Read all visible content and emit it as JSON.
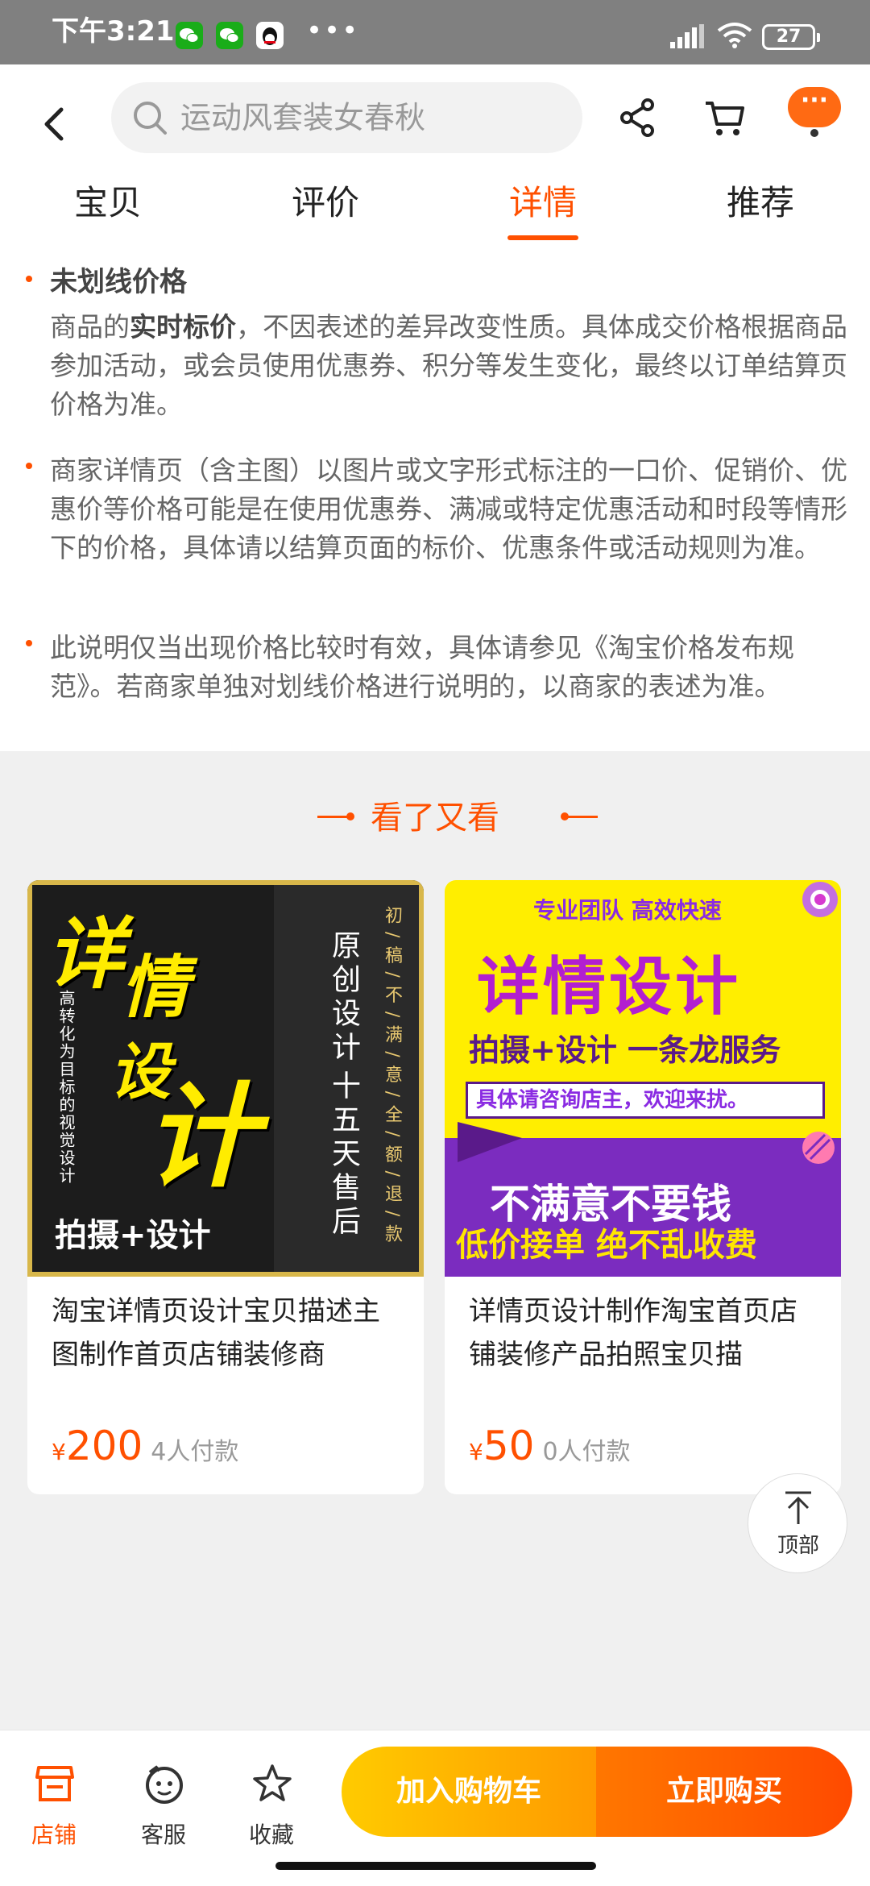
{
  "status_bar": {
    "time": "下午3:21",
    "dots": "•••",
    "battery": "27",
    "icons": [
      "wechat-icon",
      "wechat-icon",
      "qq-icon",
      "signal-icon",
      "wifi-icon",
      "battery-icon"
    ]
  },
  "header": {
    "search_placeholder": "运动风套装女春秋",
    "more_label": "···",
    "icons": [
      "back-icon",
      "search-icon",
      "share-icon",
      "cart-icon",
      "more-icon"
    ]
  },
  "tabs": [
    {
      "label": "宝贝",
      "active": false
    },
    {
      "label": "评价",
      "active": false
    },
    {
      "label": "详情",
      "active": true
    },
    {
      "label": "推荐",
      "active": false
    }
  ],
  "notice": {
    "item1_title": "未划线价格",
    "item1_prefix": "商品的",
    "item1_bold": "实时标价",
    "item1_rest": "，不因表述的差异改变性质。具体成交价格根据商品参加活动，或会员使用优惠券、积分等发生变化，最终以订单结算页价格为准。",
    "item2": "商家详情页（含主图）以图片或文字形式标注的一口价、促销价、优惠价等价格可能是在使用优惠券、满减或特定优惠活动和时段等情形下的价格，具体请以结算页面的标价、优惠条件或活动规则为准。",
    "item3": "此说明仅当出现价格比较时有效，具体请参见《淘宝价格发布规范》。若商家单独对划线价格进行说明的，以商家的表述为准。"
  },
  "see_again": {
    "title": "看了又看"
  },
  "products": [
    {
      "title": "淘宝详情页设计宝贝描述主图制作首页店铺装修商",
      "currency": "¥",
      "price": "200",
      "sold": "4人付款",
      "image": {
        "char1": "详",
        "char2": "情",
        "char3": "设",
        "char4": "计",
        "v_small": "高转化为目标的视觉设计",
        "v_big1": "原创设计",
        "v_big2": "十五天售后",
        "v_gold": "初/稿/不/满/意/全/额/退/款",
        "bottom": "拍摄+设计"
      }
    },
    {
      "title": "详情页设计制作淘宝首页店铺装修产品拍照宝贝描",
      "currency": "¥",
      "price": "50",
      "sold": "0人付款",
      "image": {
        "small": "专业团队 高效快速",
        "big": "详情设计",
        "mid": "拍摄+设计 一条龙服务",
        "box": "具体请咨询店主，欢迎来扰。",
        "white": "不满意不要钱",
        "yellow": "低价接单 绝不乱收费"
      }
    }
  ],
  "top_button": {
    "label": "顶部"
  },
  "bottom_bar": {
    "shop": "店铺",
    "service": "客服",
    "favorite": "收藏",
    "add_cart": "加入购物车",
    "buy_now": "立即购买"
  },
  "colors": {
    "accent": "#ff5000",
    "status_bar": "#808080",
    "cart_gradient": [
      "#ffcb00",
      "#ff9a00"
    ],
    "buy_gradient": [
      "#ff7700",
      "#ff4a00"
    ]
  }
}
